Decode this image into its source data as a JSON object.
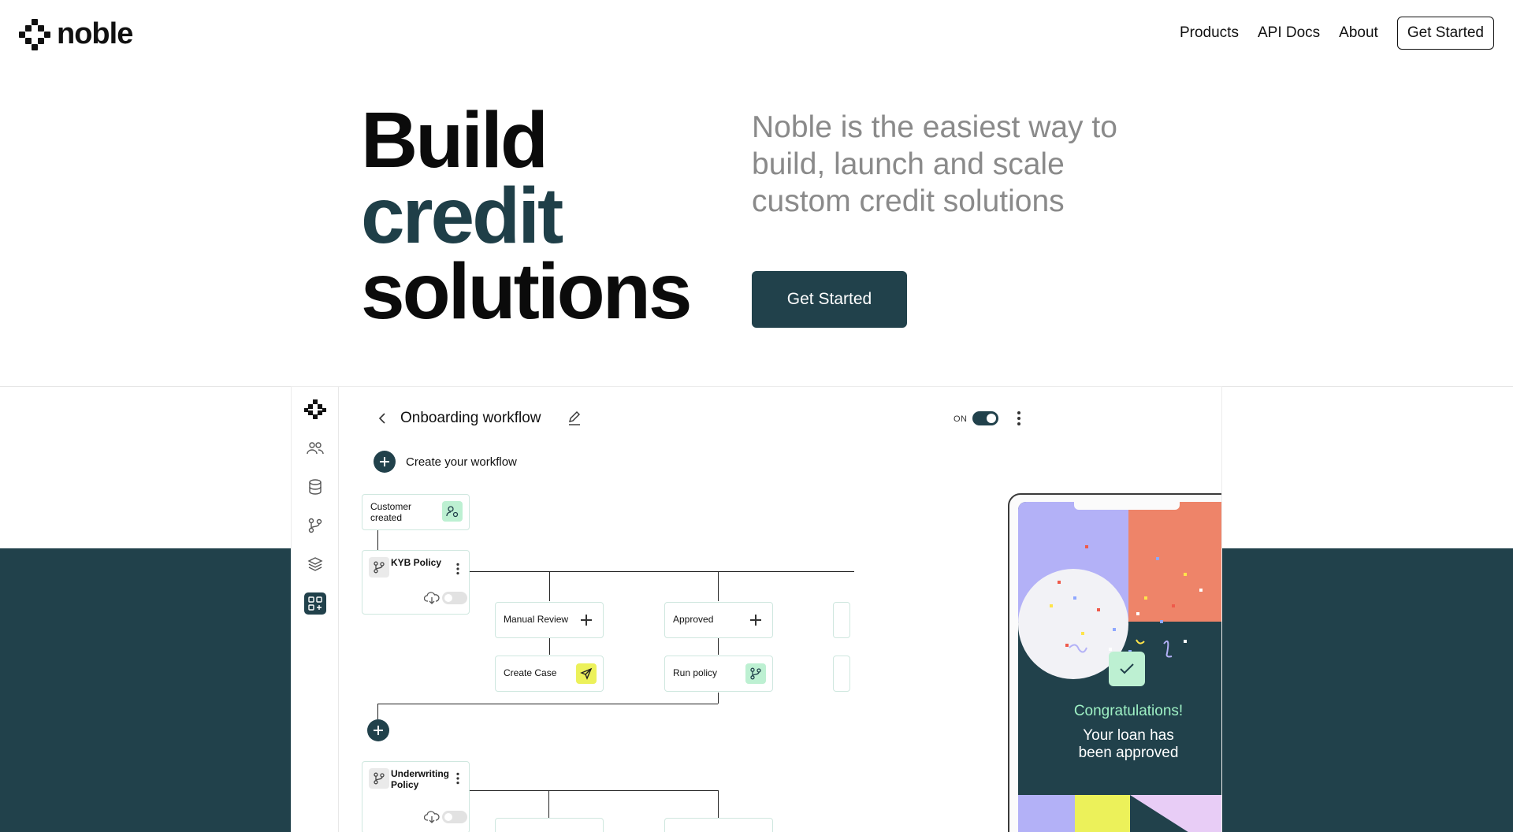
{
  "brand": {
    "name": "noble"
  },
  "nav": {
    "links": [
      "Products",
      "API Docs",
      "About"
    ],
    "cta": "Get Started"
  },
  "hero": {
    "title_line1": "Build",
    "title_line2": "credit",
    "title_line3": "solutions",
    "subtitle": "Noble is the easiest way to build, launch and scale custom credit solutions",
    "cta": "Get Started"
  },
  "app": {
    "workflow_title": "Onboarding workflow",
    "toggle_label": "ON",
    "create_label": "Create your workflow",
    "nodes": {
      "customer_created": "Customer created",
      "kyb_policy": "KYB Policy",
      "manual_review": "Manual Review",
      "approved": "Approved",
      "create_case": "Create Case",
      "run_policy": "Run policy",
      "underwriting_policy": "Underwriting Policy"
    },
    "phone": {
      "congrats": "Congratulations!",
      "message_line1": "Your loan has",
      "message_line2": "been approved"
    }
  },
  "colors": {
    "primary": "#21414b",
    "accent_green": "#bdf0d2",
    "accent_yellow": "#ecf15a",
    "accent_purple": "#b3b1f7",
    "accent_coral": "#ee8469",
    "muted_text": "#8a8a8a"
  }
}
